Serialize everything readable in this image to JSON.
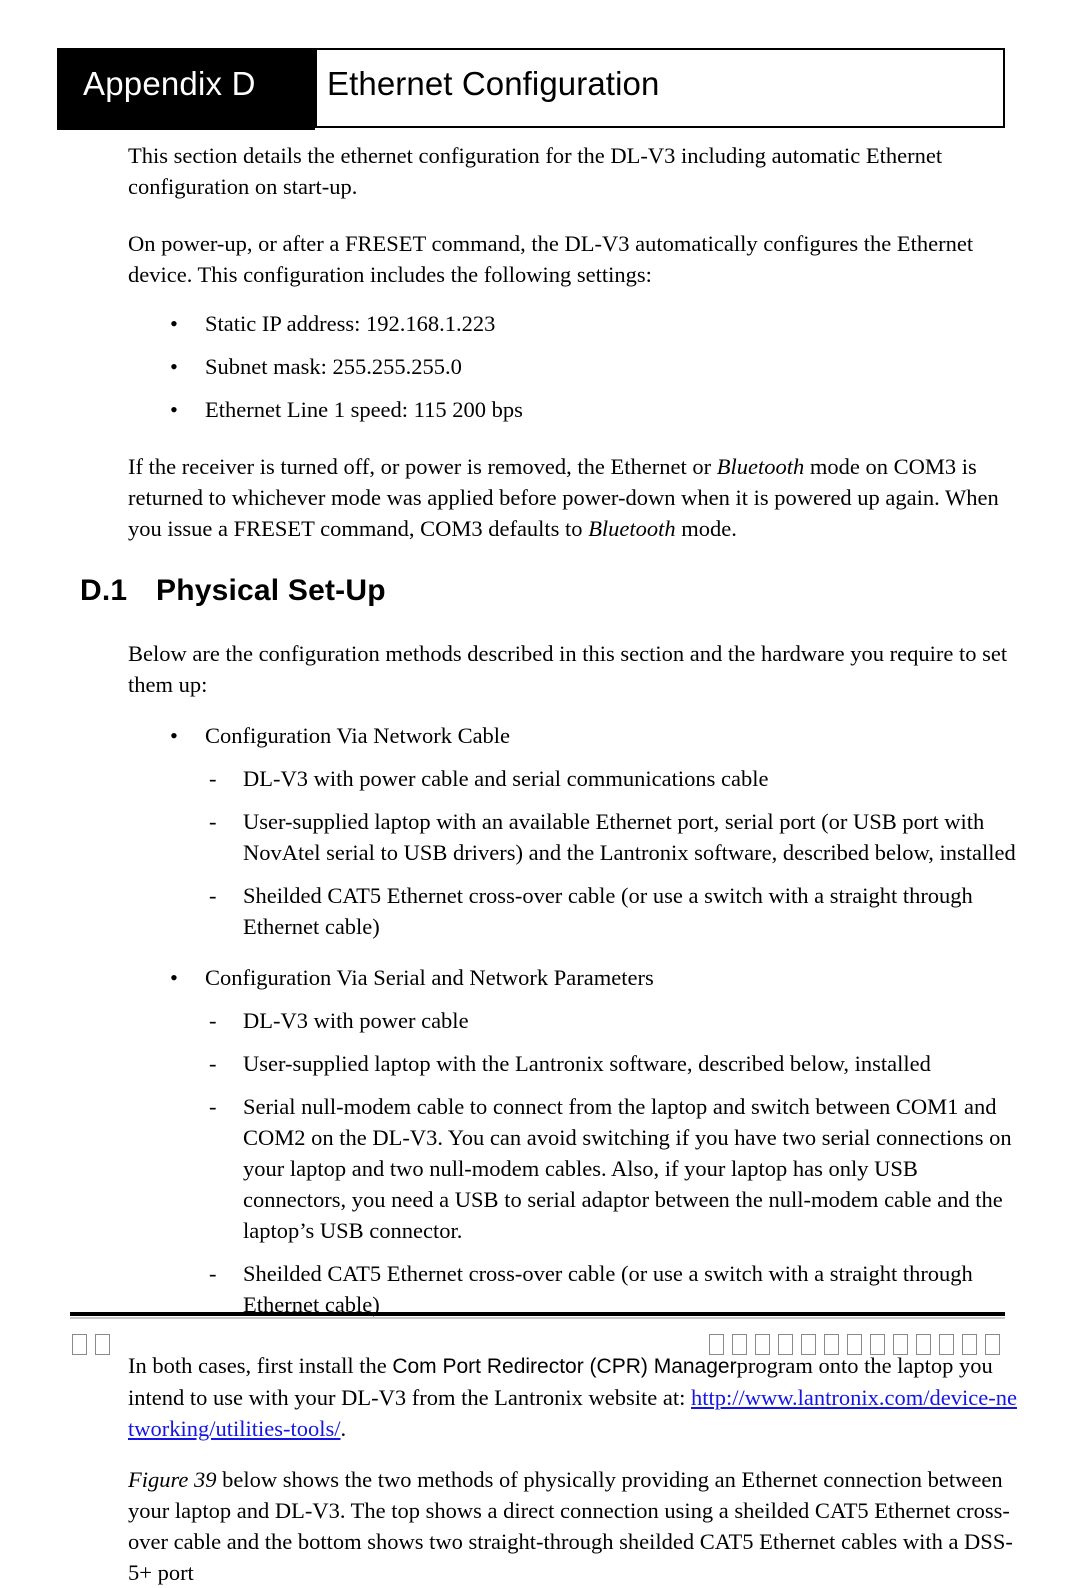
{
  "header": {
    "appendix_label": "Appendix D",
    "chapter_title": "Ethernet Configuration"
  },
  "intro": {
    "para1": "This section details the ethernet configuration for the DL-V3 including automatic Ethernet configuration on start-up.",
    "para2": "On power-up, or after a FRESET command, the DL-V3 automatically configures the Ethernet device. This configuration includes the following settings:"
  },
  "settings_list": {
    "bullet_marker": "•",
    "items": [
      "Static IP address: 192.168.1.223",
      "Subnet mask: 255.255.255.0",
      "Ethernet Line 1 speed: 115 200 bps"
    ]
  },
  "bluetooth_para": {
    "seg1": "If the receiver is turned off, or power is removed, the Ethernet or ",
    "italic1": "Bluetooth",
    "seg2": " mode on COM3 is returned to whichever mode was applied before power-down when it is powered up again. When you issue a FRESET command, COM3 defaults to ",
    "italic2": "Bluetooth",
    "seg3": " mode."
  },
  "section": {
    "number": "D.1",
    "title": "Physical Set-Up",
    "intro": "Below are the configuration methods described in this section and the hardware you require to set them up:"
  },
  "methods": {
    "bullet_marker": "•",
    "dash_marker": "-",
    "group1": {
      "title": "Configuration Via Network Cable",
      "items": [
        "DL-V3 with power cable and serial communications cable",
        "User-supplied laptop with an available Ethernet port, serial port (or USB port with NovAtel serial to USB drivers) and the Lantronix software, described below, installed",
        "Sheilded CAT5 Ethernet cross-over cable (or use a switch with a straight through Ethernet cable)"
      ]
    },
    "group2": {
      "title": "Configuration Via Serial and Network Parameters",
      "items": [
        "DL-V3 with power cable",
        "User-supplied laptop with the Lantronix software, described below, installed",
        "Serial null-modem cable to connect from the laptop and switch between COM1 and COM2 on the DL-V3. You can avoid switching if you have two serial connections on your laptop and two null-modem cables. Also, if your laptop has only USB connectors, you need a USB to serial adaptor between the null-modem cable and the laptop’s USB connector.",
        "Sheilded CAT5 Ethernet cross-over cable (or use a switch with a straight through Ethernet cable)"
      ]
    }
  },
  "install_para": {
    "seg1": "In both cases, first install the ",
    "product_name": "Com Port Redirector (CPR) Manager",
    "seg2": "program onto the laptop you intend to use with your DL-V3 from the Lantronix website at: ",
    "link_text": "http://www.lantronix.com/device-networking/utilities-tools/",
    "seg3": ".",
    "link_color": "#1414e6"
  },
  "figure_para": {
    "italic_label": "Figure 39",
    "text": " below shows the two methods of physically providing an Ethernet connection between your laptop and DL-V3. The top shows a direct connection using a sheilded CAT5 Ethernet cross-over cable and the bottom shows two straight-through sheilded CAT5 Ethernet cables with a DSS-5+ port"
  },
  "footer": {
    "left_glyph_count": 2,
    "right_glyph_count": 13,
    "glyph": "□"
  }
}
